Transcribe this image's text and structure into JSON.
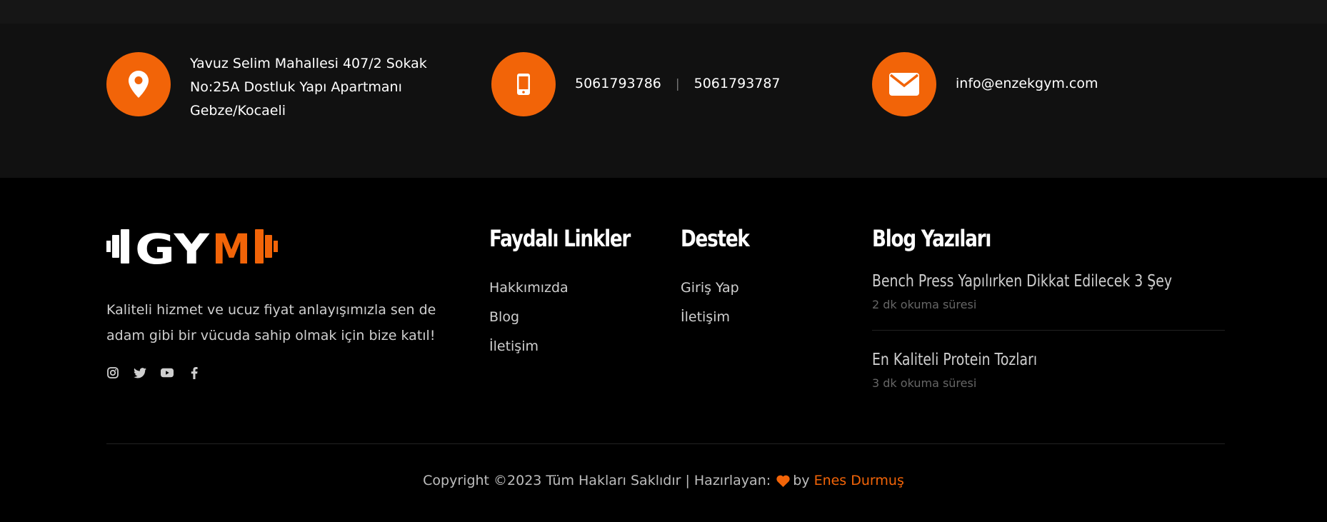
{
  "contact": {
    "address_lines": [
      "Yavuz Selim Mahallesi 407/2 Sokak",
      "No:25A Dostluk Yapı Apartmanı",
      "Gebze/Kocaeli"
    ],
    "phone_1": "5061793786",
    "phone_separator": "|",
    "phone_2": "5061793787",
    "email": "info@enzekgym.com",
    "icons": [
      "map-pin-icon",
      "mobile-phone-icon",
      "envelope-icon"
    ]
  },
  "logo": {
    "text_white": "GY",
    "text_accent": "M"
  },
  "about": {
    "text": "Kaliteli hizmet ve ucuz fiyat anlayışımızla sen de adam gibi bir vücuda sahip olmak için bize katıl!"
  },
  "social_icons": [
    "instagram-icon",
    "twitter-icon",
    "youtube-icon",
    "facebook-icon"
  ],
  "columns": {
    "useful_links": {
      "title": "Faydalı Linkler",
      "items": [
        "Hakkımızda",
        "Blog",
        "İletişim"
      ]
    },
    "support": {
      "title": "Destek",
      "items": [
        "Giriş Yap",
        "İletişim"
      ]
    },
    "blog": {
      "title": "Blog Yazıları",
      "posts": [
        {
          "title": "Bench Press Yapılırken Dikkat Edilecek 3 Şey",
          "meta": "2 dk okuma süresi"
        },
        {
          "title": "En Kaliteli Protein Tozları",
          "meta": "3 dk okuma süresi"
        }
      ]
    }
  },
  "copyright": {
    "text": "Copyright ©2023 Tüm Hakları Saklıdır | Hazırlayan:",
    "by": "by",
    "author": "Enes Durmuş"
  },
  "colors": {
    "accent": "#f26408",
    "band_background": "#111111",
    "footer_background": "#000000"
  }
}
